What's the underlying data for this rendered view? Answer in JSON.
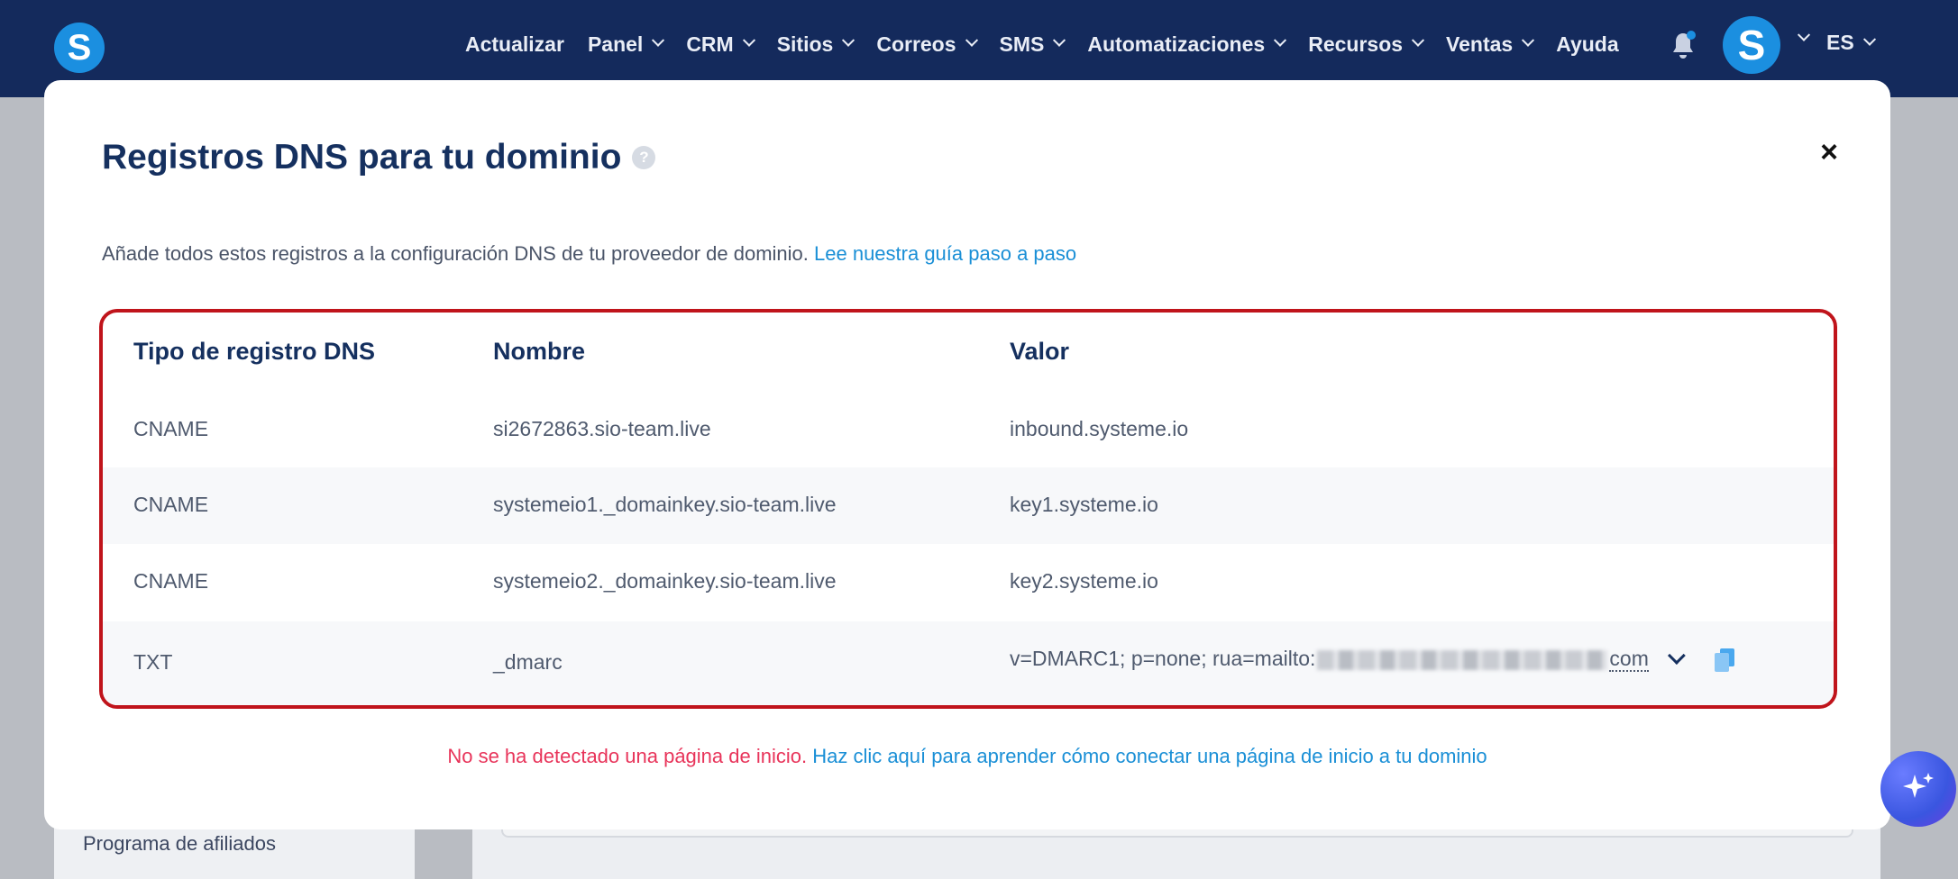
{
  "nav": {
    "logo_letter": "S",
    "items": [
      {
        "label": "Actualizar",
        "dropdown": false
      },
      {
        "label": "Panel",
        "dropdown": true
      },
      {
        "label": "CRM",
        "dropdown": true
      },
      {
        "label": "Sitios",
        "dropdown": true
      },
      {
        "label": "Correos",
        "dropdown": true
      },
      {
        "label": "SMS",
        "dropdown": true
      },
      {
        "label": "Automatizaciones",
        "dropdown": true
      },
      {
        "label": "Recursos",
        "dropdown": true
      },
      {
        "label": "Ventas",
        "dropdown": true
      },
      {
        "label": "Ayuda",
        "dropdown": false
      }
    ],
    "avatar_letter": "S",
    "language": "ES"
  },
  "background": {
    "sidebar_item": "Programa de afiliados"
  },
  "modal": {
    "title": "Registros DNS para tu dominio",
    "help_glyph": "?",
    "close_glyph": "×",
    "intro_text": "Añade todos estos registros a la configuración DNS de tu proveedor de dominio. ",
    "intro_link": "Lee nuestra guía paso a paso",
    "table": {
      "headers": [
        "Tipo de registro DNS",
        "Nombre",
        "Valor"
      ],
      "rows": [
        [
          "CNAME",
          "si2672863.sio-team.live",
          "inbound.systeme.io"
        ],
        [
          "CNAME",
          "systemeio1._domainkey.sio-team.live",
          "key1.systeme.io"
        ],
        [
          "CNAME",
          "systemeio2._domainkey.sio-team.live",
          "key2.systeme.io"
        ],
        [
          "TXT",
          "_dmarc",
          "v=DMARC1; p=none; rua=mailto:"
        ]
      ],
      "txt_value_suffix": "com"
    },
    "footer_warning": "No se ha detectado una página de inicio. ",
    "footer_link": "Haz clic aquí para aprender cómo conectar una página de inicio a tu dominio"
  },
  "colors": {
    "nav_bg": "#142a5c",
    "brand_blue": "#1b8fe0",
    "title": "#15305f",
    "highlight_border": "#c0141b",
    "link": "#1a8fd6",
    "warning": "#e8345a"
  }
}
